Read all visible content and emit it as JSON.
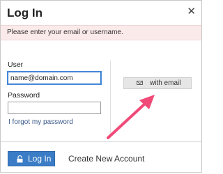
{
  "dialog": {
    "title": "Log In",
    "close_icon": "close-icon"
  },
  "notice": {
    "text": "Please enter your email or username."
  },
  "form": {
    "user_label": "User",
    "user_value": "name@domain.com",
    "password_label": "Password",
    "password_value": "",
    "forgot_link": "I forgot my password"
  },
  "alt_login": {
    "email_button_label": "with email",
    "email_icon": "envelope-icon"
  },
  "footer": {
    "login_button_label": "Log In",
    "login_icon": "lock-icon",
    "create_account_link": "Create New Account"
  },
  "colors": {
    "notice_bg": "#fbeaea",
    "primary_button": "#3a7cc5",
    "arrow": "#f04a78",
    "focus_border": "#2b72c4"
  }
}
